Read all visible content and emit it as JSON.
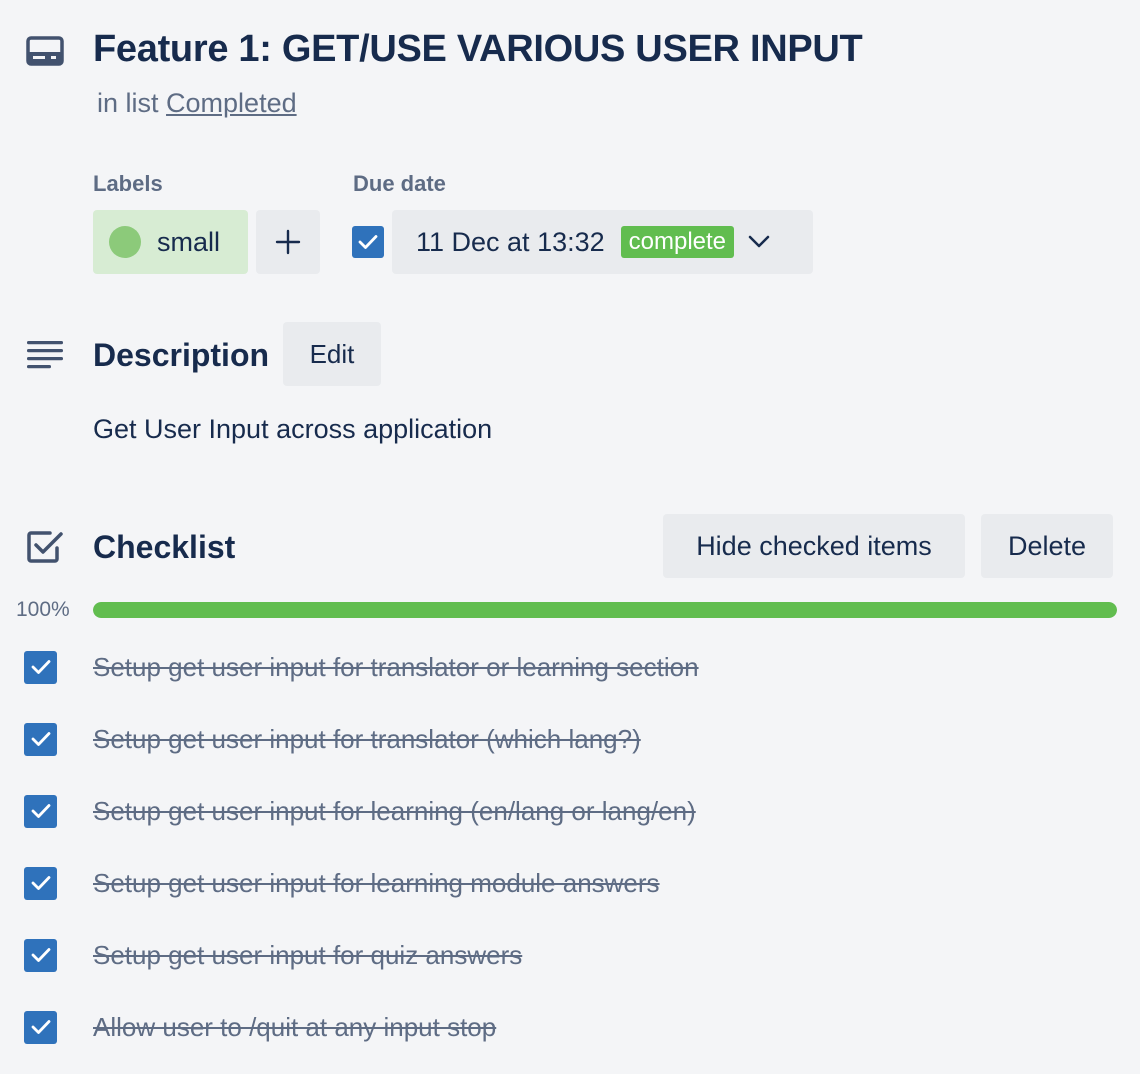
{
  "header": {
    "title": "Feature 1: GET/USE VARIOUS USER INPUT",
    "in_list_prefix": "in list",
    "list_name": "Completed"
  },
  "labels": {
    "heading": "Labels",
    "items": [
      {
        "text": "small",
        "color": "#8cca7a",
        "background": "#d7ecd3"
      }
    ]
  },
  "due_date": {
    "heading": "Due date",
    "checked": true,
    "value": "11 Dec at 13:32",
    "status": "complete",
    "status_color": "#61bd4f"
  },
  "description": {
    "heading": "Description",
    "edit_label": "Edit",
    "text": "Get User Input across application"
  },
  "checklist": {
    "heading": "Checklist",
    "hide_label": "Hide checked items",
    "delete_label": "Delete",
    "progress_text": "100%",
    "progress_fraction": 1.0,
    "progress_color": "#61bd4f",
    "items": [
      {
        "text": "Setup get user input for translator or learning section",
        "checked": true
      },
      {
        "text": "Setup get user input for translator (which lang?)",
        "checked": true
      },
      {
        "text": "Setup get user input for learning (en/lang or lang/en)",
        "checked": true
      },
      {
        "text": "Setup get user input for learning module answers",
        "checked": true
      },
      {
        "text": "Setup get user input for quiz answers",
        "checked": true
      },
      {
        "text": "Allow user to /quit at any input stop",
        "checked": true
      }
    ]
  },
  "icons": {
    "card": "card-icon",
    "description": "description-icon",
    "checklist": "checklist-icon",
    "add": "plus-icon",
    "chevron": "chevron-down-icon",
    "check": "checkmark-icon"
  },
  "colors": {
    "accent_blue": "#2f72bb",
    "text_primary": "#172b4d",
    "text_secondary": "#5e6c84",
    "button_bg": "#e9ebee",
    "page_bg": "#f4f5f7"
  }
}
